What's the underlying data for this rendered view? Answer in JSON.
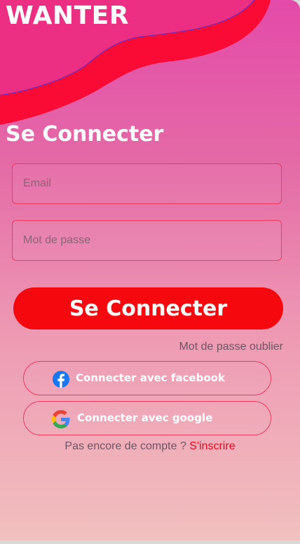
{
  "app": {
    "brand": "WANTER"
  },
  "login": {
    "title": "Se Connecter",
    "email_placeholder": "Email",
    "password_placeholder": "Mot de passe",
    "submit_label": "Se Connecter",
    "forgot_label": "Mot de passe oublier"
  },
  "social": {
    "facebook_label": "Connecter avec facebook",
    "google_label": "Connecter avec google"
  },
  "signup": {
    "prompt": "Pas encore de compte ?",
    "link_label": "S'inscrire"
  },
  "icons": {
    "facebook": "facebook-icon",
    "google": "google-icon"
  },
  "colors": {
    "accent": "#f5090e",
    "wave": "#f90b36",
    "gradient_top": "#e44aa9",
    "gradient_bottom": "#f1c0bf",
    "field_border": "#ef3a5e",
    "facebook_blue": "#1877f2"
  }
}
